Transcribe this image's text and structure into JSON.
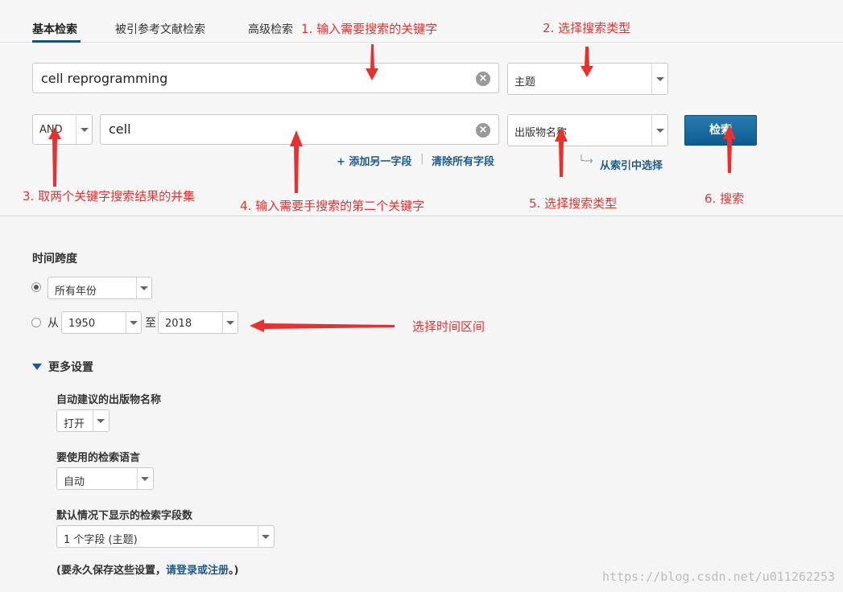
{
  "tabs": [
    {
      "label": "基本检索",
      "active": true
    },
    {
      "label": "被引参考文献检索",
      "active": false
    },
    {
      "label": "高级检索",
      "active": false
    }
  ],
  "query_rows": [
    {
      "operator": "",
      "value": "cell reprogramming",
      "field": "主题"
    },
    {
      "operator": "AND",
      "value": "cell",
      "field": "出版物名称"
    }
  ],
  "actions": {
    "add_field": "+ 添加另一字段",
    "separator": "|",
    "clear_fields": "清除所有字段",
    "index_select": "从索引中选择",
    "index_arrow": "└→",
    "search_button": "检索"
  },
  "annotations": {
    "a1": "1.  输入需要搜索的关键字",
    "a2": "2.  选择搜索类型",
    "a3": "3.  取两个关键字搜索结果的并集",
    "a4": "4.  输入需要手搜索的第二个关键字",
    "a5": "5.  选择搜索类型",
    "a6": "6.  搜索",
    "a7": "选择时间区间"
  },
  "timespan": {
    "title": "时间跨度",
    "all_years": "所有年份",
    "from_label": "从",
    "from_year": "1950",
    "to_label": "至",
    "to_year": "2018"
  },
  "more_settings": {
    "title": "更多设置",
    "auto_suggest_label": "自动建议的出版物名称",
    "auto_suggest_value": "打开",
    "language_label": "要使用的检索语言",
    "language_value": "自动",
    "fields_label": "默认情况下显示的检索字段数",
    "fields_value": "1 个字段 (主题)",
    "save_note_prefix": "(要永久保存这些设置，",
    "save_note_link": "请登录或注册",
    "save_note_suffix": "。)"
  },
  "colors": {
    "accent": "#1f5a8a",
    "annotation": "#e8312f",
    "button": "#0b5d91"
  },
  "watermark": "https://blog.csdn.net/u011262253"
}
